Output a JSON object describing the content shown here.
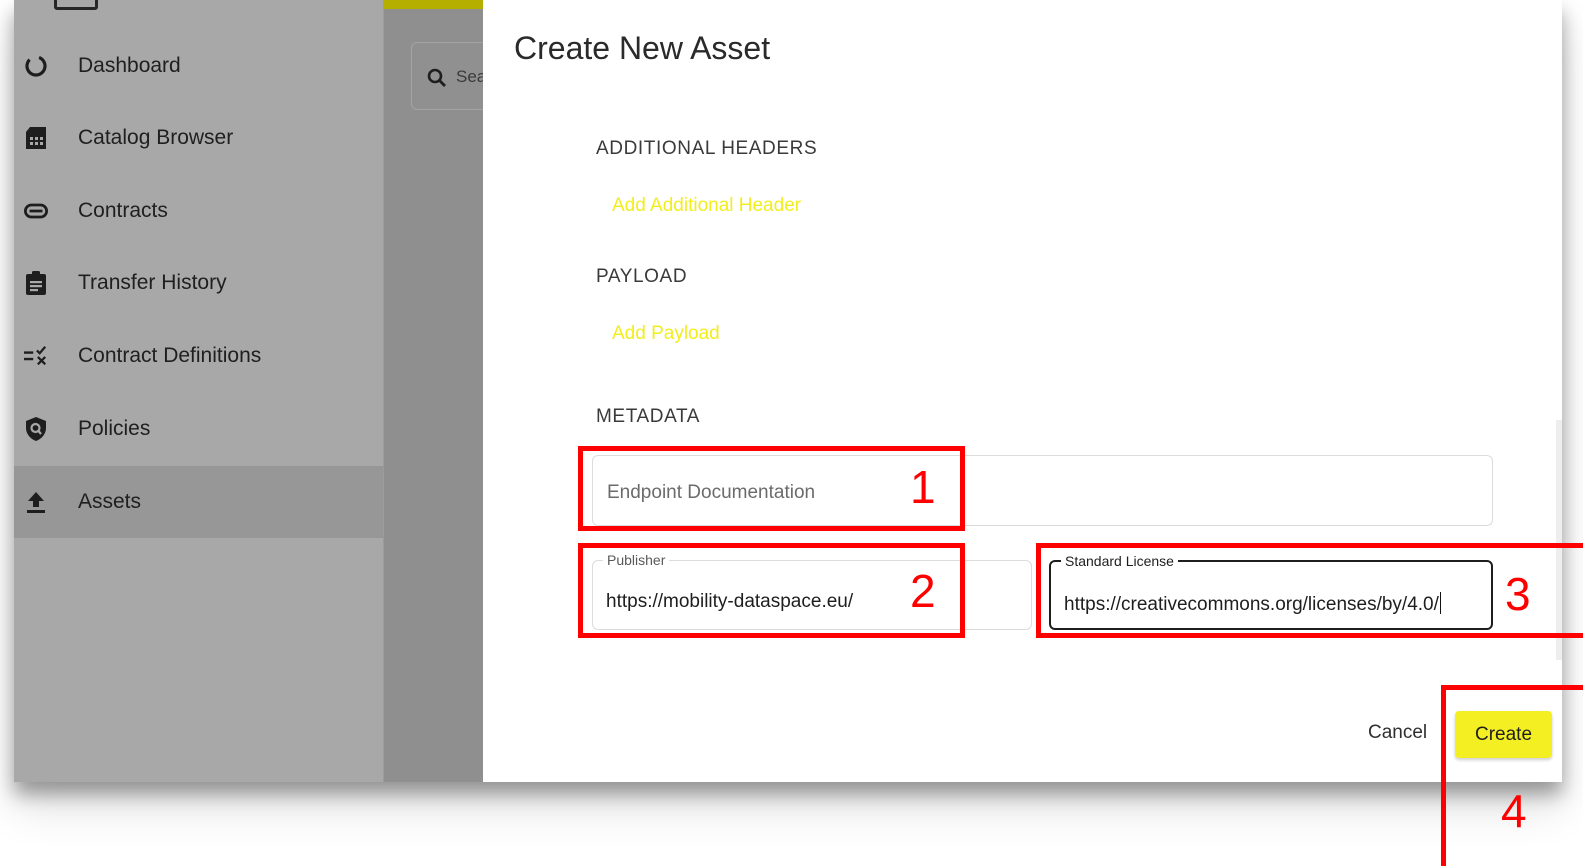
{
  "sidebar": {
    "items": [
      {
        "label": "Dashboard",
        "icon": "dashboard-icon"
      },
      {
        "label": "Catalog Browser",
        "icon": "catalog-icon"
      },
      {
        "label": "Contracts",
        "icon": "contracts-icon"
      },
      {
        "label": "Transfer History",
        "icon": "clipboard-icon"
      },
      {
        "label": "Contract Definitions",
        "icon": "rule-icon"
      },
      {
        "label": "Policies",
        "icon": "policy-icon"
      },
      {
        "label": "Assets",
        "icon": "upload-icon",
        "active": true
      }
    ]
  },
  "background": {
    "search_placeholder": "Sea"
  },
  "dialog": {
    "title": "Create New Asset",
    "additional_headers": {
      "label": "ADDITIONAL HEADERS",
      "add_label": "Add Additional Header"
    },
    "payload": {
      "label": "PAYLOAD",
      "add_label": "Add Payload"
    },
    "metadata": {
      "label": "METADATA",
      "endpoint_documentation": {
        "placeholder": "Endpoint Documentation"
      },
      "publisher": {
        "label": "Publisher",
        "value": "https://mobility-dataspace.eu/"
      },
      "standard_license": {
        "label": "Standard License",
        "value": "https://creativecommons.org/licenses/by/4.0/"
      }
    },
    "cancel_label": "Cancel",
    "create_label": "Create"
  },
  "annotations": {
    "n1": "1",
    "n2": "2",
    "n3": "3",
    "n4": "4",
    "color": "#ff0000"
  },
  "colors": {
    "accent_yellow": "#f4ef22",
    "overlay_gray": "#a8a8a8"
  }
}
